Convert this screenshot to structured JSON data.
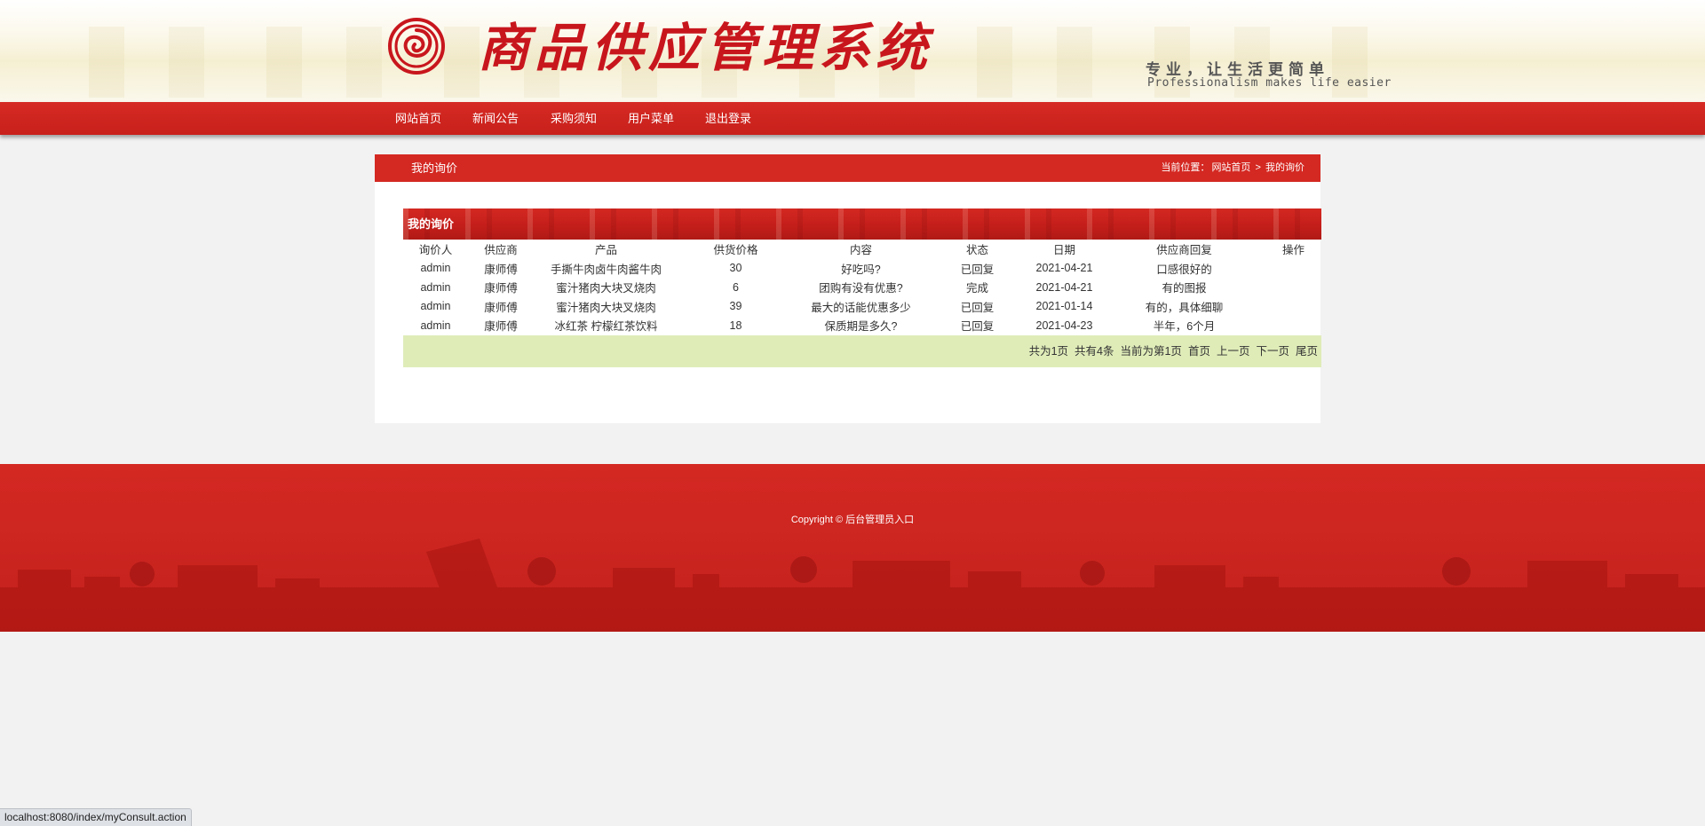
{
  "header": {
    "site_title": "商品供应管理系统",
    "slogan_cn": "专业，让生活更简单",
    "slogan_en": "Professionalism makes life easier"
  },
  "nav": {
    "items": [
      {
        "label": "网站首页"
      },
      {
        "label": "新闻公告"
      },
      {
        "label": "采购须知"
      },
      {
        "label": "用户菜单"
      },
      {
        "label": "退出登录"
      }
    ]
  },
  "main": {
    "title": "我的询价",
    "breadcrumb": {
      "prefix": "当前位置：",
      "home": "网站首页",
      "separator": ">",
      "current": "我的询价"
    },
    "panel_title": "我的询价",
    "table": {
      "columns": [
        "询价人",
        "供应商",
        "产品",
        "供货价格",
        "内容",
        "状态",
        "日期",
        "供应商回复",
        "操作"
      ],
      "rows": [
        [
          "admin",
          "康师傅",
          "手撕牛肉卤牛肉酱牛肉",
          "30",
          "好吃吗?",
          "已回复",
          "2021-04-21",
          "口感很好的",
          ""
        ],
        [
          "admin",
          "康师傅",
          "蜜汁猪肉大块叉烧肉",
          "6",
          "团购有没有优惠?",
          "完成",
          "2021-04-21",
          "有的图报",
          ""
        ],
        [
          "admin",
          "康师傅",
          "蜜汁猪肉大块叉烧肉",
          "39",
          "最大的话能优惠多少",
          "已回复",
          "2021-01-14",
          "有的，具体细聊",
          ""
        ],
        [
          "admin",
          "康师傅",
          "冰红茶 柠檬红茶饮料",
          "18",
          "保质期是多久?",
          "已回复",
          "2021-04-23",
          "半年，6个月",
          ""
        ]
      ]
    },
    "pager": {
      "total_pages": "共为1页",
      "total_records": "共有4条",
      "current_page": "当前为第1页",
      "first": "首页",
      "prev": "上一页",
      "next": "下一页",
      "last": "尾页"
    }
  },
  "footer": {
    "copyright_prefix": "Copyright ©",
    "admin_link": "后台管理员入口"
  },
  "statusbar": {
    "url": "localhost:8080/index/myConsult.action"
  },
  "colors": {
    "brand_red": "#d42822",
    "pager_bg": "#dfecb8",
    "page_bg": "#f2f2f2"
  }
}
